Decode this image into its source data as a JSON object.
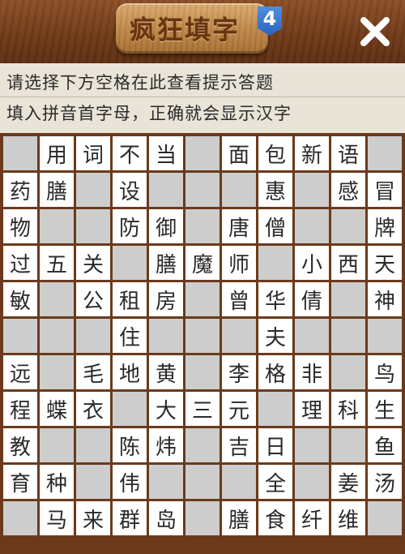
{
  "header": {
    "title": "疯狂填字",
    "level": "4",
    "close_icon": "close-x-icon"
  },
  "hints": {
    "line1": "请选择下方空格在此查看提示答题",
    "line2": "填入拼音首字母，正确就会显示汉字"
  },
  "colors": {
    "wood_dark": "#6b3a1c",
    "plaque": "#c08747",
    "badge_blue": "#2a63bf",
    "blank_cell": "#cdcdcd",
    "filled_cell": "#ffffff"
  },
  "grid": {
    "rows": [
      [
        "",
        "用",
        "词",
        "不",
        "当",
        "",
        "面",
        "包",
        "新",
        "语",
        ""
      ],
      [
        "药",
        "膳",
        "",
        "设",
        "",
        "",
        "",
        "惠",
        "",
        "感",
        "冒"
      ],
      [
        "物",
        "",
        "",
        "防",
        "御",
        "",
        "唐",
        "僧",
        "",
        "",
        "牌"
      ],
      [
        "过",
        "五",
        "关",
        "",
        "膳",
        "魔",
        "师",
        "",
        "小",
        "西",
        "天"
      ],
      [
        "敏",
        "",
        "公",
        "租",
        "房",
        "",
        "曾",
        "华",
        "倩",
        "",
        "神"
      ],
      [
        "",
        "",
        "",
        "住",
        "",
        "",
        "",
        "夫",
        "",
        "",
        ""
      ],
      [
        "远",
        "",
        "毛",
        "地",
        "黄",
        "",
        "李",
        "格",
        "非",
        "",
        "鸟"
      ],
      [
        "程",
        "蝶",
        "衣",
        "",
        "大",
        "三",
        "元",
        "",
        "理",
        "科",
        "生"
      ],
      [
        "教",
        "",
        "",
        "陈",
        "炜",
        "",
        "吉",
        "日",
        "",
        "",
        "鱼"
      ],
      [
        "育",
        "种",
        "",
        "伟",
        "",
        "",
        "",
        "全",
        "",
        "姜",
        "汤"
      ],
      [
        "",
        "马",
        "来",
        "群",
        "岛",
        "",
        "膳",
        "食",
        "纤",
        "维",
        ""
      ]
    ]
  }
}
